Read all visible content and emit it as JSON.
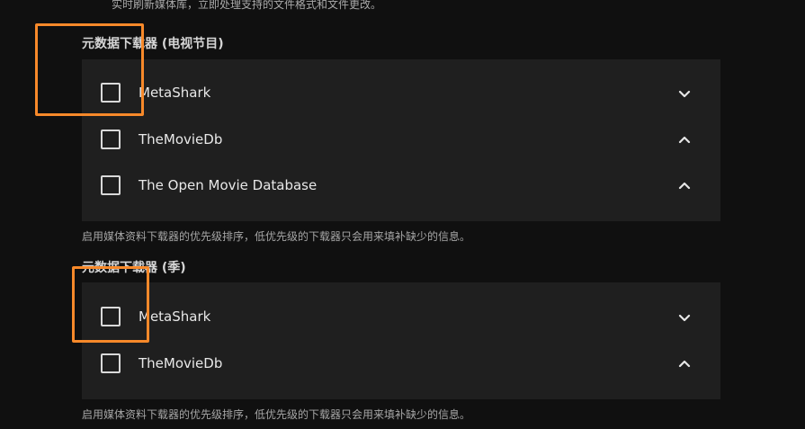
{
  "top_description": "实时刷新媒体库，立即处理支持的文件格式和文件更改。",
  "sections": [
    {
      "title": "元数据下载器 (电视节目)",
      "items": [
        {
          "label": "MetaShark",
          "chevron": "chevron-down"
        },
        {
          "label": "TheMovieDb",
          "chevron": "chevron-up"
        },
        {
          "label": "The Open Movie Database",
          "chevron": "chevron-up"
        }
      ],
      "help": "启用媒体资料下载器的优先级排序，低优先级的下载器只会用来填补缺少的信息。"
    },
    {
      "title": "元数据下载器 (季)",
      "items": [
        {
          "label": "MetaShark",
          "chevron": "chevron-down"
        },
        {
          "label": "TheMovieDb",
          "chevron": "chevron-up"
        }
      ],
      "help": "启用媒体资料下载器的优先级排序，低优先级的下载器只会用来填补缺少的信息。"
    }
  ],
  "colors": {
    "background": "#101010",
    "panel": "#1f1f1f",
    "highlight": "#f7892a"
  }
}
